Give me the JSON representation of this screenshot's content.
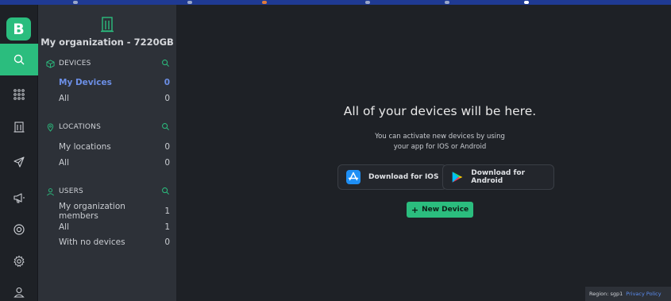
{
  "app": {
    "logo_letter": "B",
    "brand_color": "#2bbd7e"
  },
  "rail": {
    "items": [
      {
        "name": "search-icon",
        "active": true
      },
      {
        "name": "apps-grid-icon",
        "active": false
      },
      {
        "name": "building-icon",
        "active": false
      },
      {
        "name": "send-icon",
        "active": false
      },
      {
        "name": "megaphone-icon",
        "active": false
      },
      {
        "name": "help-lifebuoy-icon",
        "active": false
      },
      {
        "name": "settings-gear-icon",
        "active": false
      },
      {
        "name": "user-account-icon",
        "active": false
      }
    ]
  },
  "sidebar": {
    "org_name": "My organization - 7220GB",
    "devices": {
      "title": "DEVICES",
      "items": [
        {
          "label": "My Devices",
          "count": "0"
        },
        {
          "label": "All",
          "count": "0"
        }
      ]
    },
    "locations": {
      "title": "LOCATIONS",
      "items": [
        {
          "label": "My locations",
          "count": "0"
        },
        {
          "label": "All",
          "count": "0"
        }
      ]
    },
    "users": {
      "title": "USERS",
      "items": [
        {
          "label": "My organization members",
          "count": "1"
        },
        {
          "label": "All",
          "count": "1"
        },
        {
          "label": "With no devices",
          "count": "0"
        }
      ]
    }
  },
  "main": {
    "headline": "All of your devices will be here.",
    "sub_line1": "You can activate new devices by using",
    "sub_line2": "your app for IOS or Android",
    "ios_button": "Download for IOS",
    "android_button": "Download for Android",
    "new_device_button": "New Device",
    "new_device_plus": "+"
  },
  "footer": {
    "region": "Region: sgp1",
    "privacy": "Privacy Policy"
  }
}
